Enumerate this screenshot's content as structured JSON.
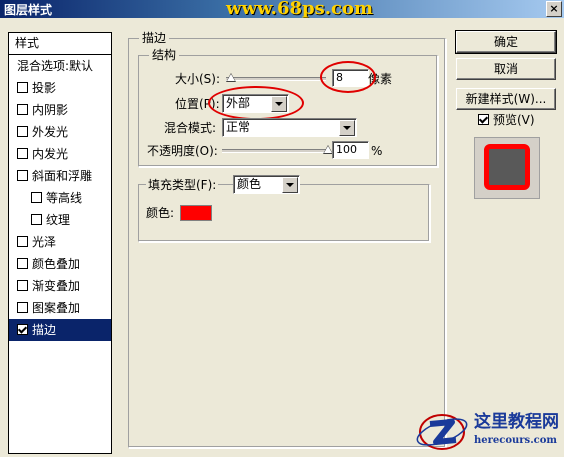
{
  "window": {
    "title": "图层样式",
    "close": "×",
    "watermark": "www.68ps.com"
  },
  "styles_list": {
    "header": "样式",
    "items": [
      {
        "label": "混合选项:默认",
        "checkbox": false,
        "sub": false,
        "checked": false,
        "selected": false
      },
      {
        "label": "投影",
        "checkbox": true,
        "sub": false,
        "checked": false,
        "selected": false
      },
      {
        "label": "内阴影",
        "checkbox": true,
        "sub": false,
        "checked": false,
        "selected": false
      },
      {
        "label": "外发光",
        "checkbox": true,
        "sub": false,
        "checked": false,
        "selected": false
      },
      {
        "label": "内发光",
        "checkbox": true,
        "sub": false,
        "checked": false,
        "selected": false
      },
      {
        "label": "斜面和浮雕",
        "checkbox": true,
        "sub": false,
        "checked": false,
        "selected": false
      },
      {
        "label": "等高线",
        "checkbox": true,
        "sub": true,
        "checked": false,
        "selected": false
      },
      {
        "label": "纹理",
        "checkbox": true,
        "sub": true,
        "checked": false,
        "selected": false
      },
      {
        "label": "光泽",
        "checkbox": true,
        "sub": false,
        "checked": false,
        "selected": false
      },
      {
        "label": "颜色叠加",
        "checkbox": true,
        "sub": false,
        "checked": false,
        "selected": false
      },
      {
        "label": "渐变叠加",
        "checkbox": true,
        "sub": false,
        "checked": false,
        "selected": false
      },
      {
        "label": "图案叠加",
        "checkbox": true,
        "sub": false,
        "checked": false,
        "selected": false
      },
      {
        "label": "描边",
        "checkbox": true,
        "sub": false,
        "checked": true,
        "selected": true
      }
    ]
  },
  "stroke": {
    "group_title": "描边",
    "structure_title": "结构",
    "size_label": "大小(S):",
    "size_value": "8",
    "size_unit": "像素",
    "position_label": "位置(P):",
    "position_value": "外部",
    "blend_label": "混合模式:",
    "blend_value": "正常",
    "opacity_label": "不透明度(O):",
    "opacity_value": "100",
    "opacity_unit": "%",
    "opacity_level": 1.0,
    "fill_type_label": "填充类型(F):",
    "fill_type_value": "颜色",
    "color_label": "颜色:",
    "color_value": "#ff0000"
  },
  "buttons": {
    "ok": "确定",
    "cancel": "取消",
    "new_style": "新建样式(W)...",
    "preview_label": "预览(V)",
    "preview_checked": true
  },
  "logo": {
    "line1": "这里教程网",
    "line2": "herecours.com"
  }
}
